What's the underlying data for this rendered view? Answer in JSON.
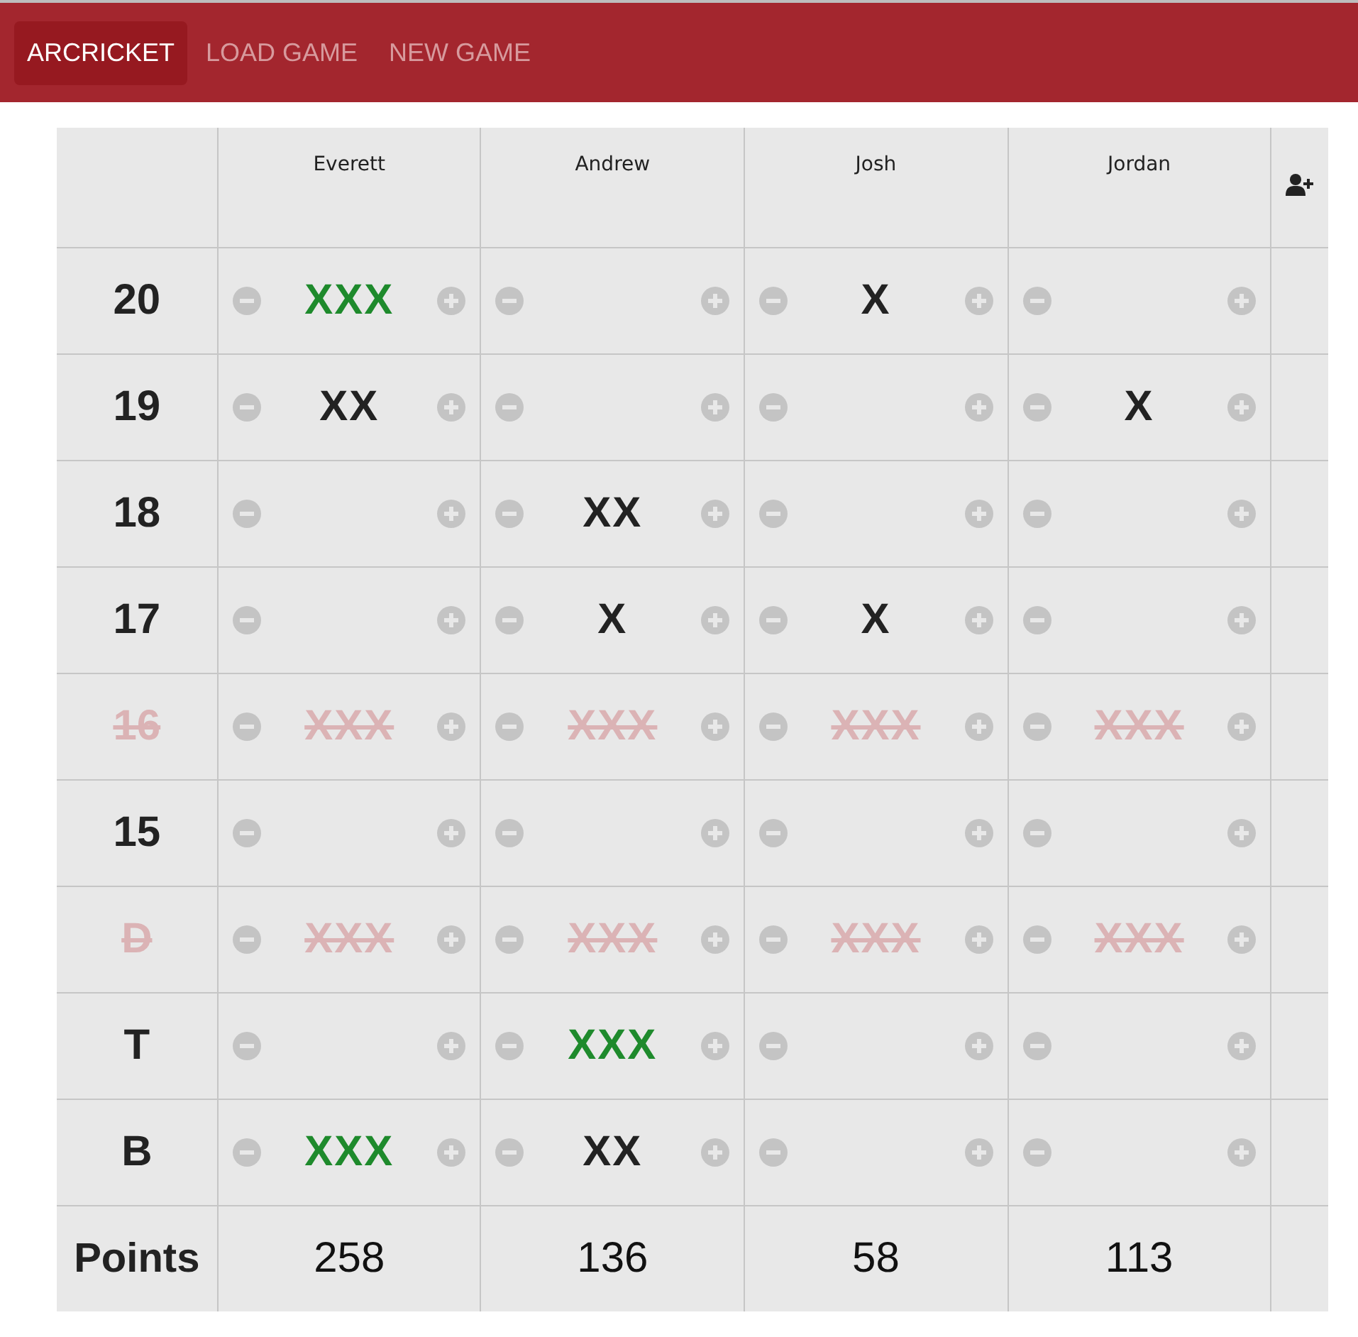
{
  "nav": [
    {
      "label": "ARCRICKET",
      "selected": true
    },
    {
      "label": "LOAD GAME",
      "selected": false
    },
    {
      "label": "NEW GAME",
      "selected": false
    }
  ],
  "players": [
    "Everett",
    "Andrew",
    "Josh",
    "Jordan"
  ],
  "rows": [
    {
      "label": "20",
      "closed": false,
      "cells": [
        {
          "marks": "XXX",
          "complete": true
        },
        {},
        {
          "marks": "X",
          "complete": false
        },
        {}
      ]
    },
    {
      "label": "19",
      "closed": false,
      "cells": [
        {
          "marks": "XX",
          "complete": false
        },
        {},
        {},
        {
          "marks": "X",
          "complete": false
        }
      ]
    },
    {
      "label": "18",
      "closed": false,
      "cells": [
        {},
        {
          "marks": "XX",
          "complete": false
        },
        {},
        {}
      ]
    },
    {
      "label": "17",
      "closed": false,
      "cells": [
        {},
        {
          "marks": "X",
          "complete": false
        },
        {
          "marks": "X",
          "complete": false
        },
        {}
      ]
    },
    {
      "label": "16",
      "closed": true,
      "cells": [
        {
          "marks": "XXX"
        },
        {
          "marks": "XXX"
        },
        {
          "marks": "XXX"
        },
        {
          "marks": "XXX"
        }
      ]
    },
    {
      "label": "15",
      "closed": false,
      "cells": [
        {},
        {},
        {},
        {}
      ]
    },
    {
      "label": "D",
      "closed": true,
      "cells": [
        {
          "marks": "XXX"
        },
        {
          "marks": "XXX"
        },
        {
          "marks": "XXX"
        },
        {
          "marks": "XXX"
        }
      ]
    },
    {
      "label": "T",
      "closed": false,
      "cells": [
        {},
        {
          "marks": "XXX",
          "complete": true
        },
        {},
        {}
      ]
    },
    {
      "label": "B",
      "closed": false,
      "cells": [
        {
          "marks": "XXX",
          "complete": true
        },
        {
          "marks": "XX",
          "complete": false
        },
        {},
        {}
      ]
    }
  ],
  "points": {
    "label": "Points",
    "values": [
      "258",
      "136",
      "58",
      "113"
    ]
  }
}
